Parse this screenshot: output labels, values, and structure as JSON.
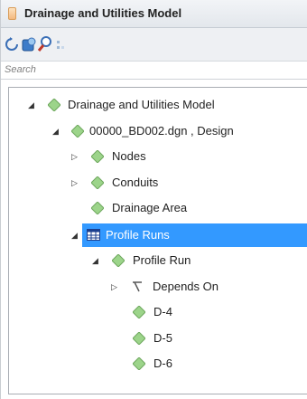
{
  "panel": {
    "title": "Drainage and Utilities Model"
  },
  "toolbar": {
    "buttons": [
      "refresh-icon",
      "model-icon",
      "zoom-icon",
      "more-icon"
    ]
  },
  "search": {
    "placeholder": "Search"
  },
  "tree": {
    "root": "Drainage and Utilities Model",
    "design": "00000_BD002.dgn , Design",
    "nodes": "Nodes",
    "conduits": "Conduits",
    "drainage_area": "Drainage Area",
    "profile_runs": "Profile Runs",
    "profile_run": "Profile Run",
    "depends_on": "Depends On",
    "d4": "D-4",
    "d5": "D-5",
    "d6": "D-6"
  },
  "colors": {
    "selection": "#3399ff",
    "diamond_fill": "#9cd48a",
    "diamond_edge": "#6fa85f"
  }
}
